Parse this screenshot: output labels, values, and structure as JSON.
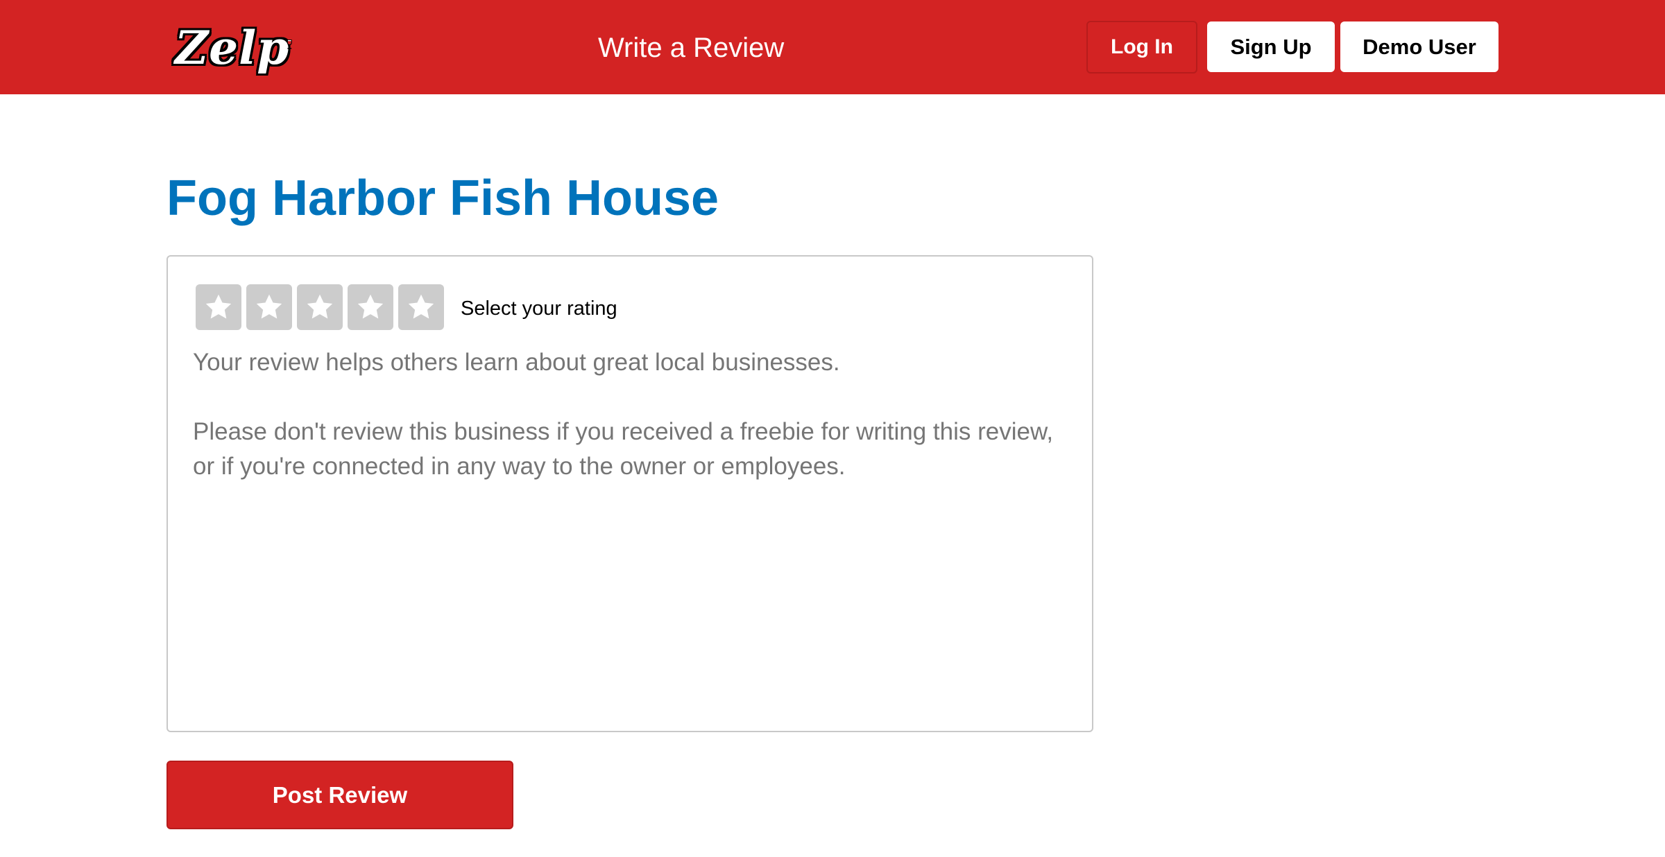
{
  "header": {
    "logo_text": "Zelp",
    "title": "Write a Review",
    "login_label": "Log In",
    "signup_label": "Sign Up",
    "demo_label": "Demo User",
    "brand_color": "#d32323"
  },
  "business": {
    "name": "Fog Harbor Fish House",
    "name_color": "#0073bb"
  },
  "review_form": {
    "rating_label": "Select your rating",
    "rating_value": 0,
    "rating_max": 5,
    "placeholder_line1": "Your review helps others learn about great local businesses.",
    "placeholder_line2": "Please don't review this business if you received a freebie for writing this review, or if you're connected in any way to the owner or employees.",
    "review_value": "",
    "submit_label": "Post Review"
  },
  "icons": {
    "logo_glass": "wine-glass-icon",
    "star": "star-icon"
  }
}
